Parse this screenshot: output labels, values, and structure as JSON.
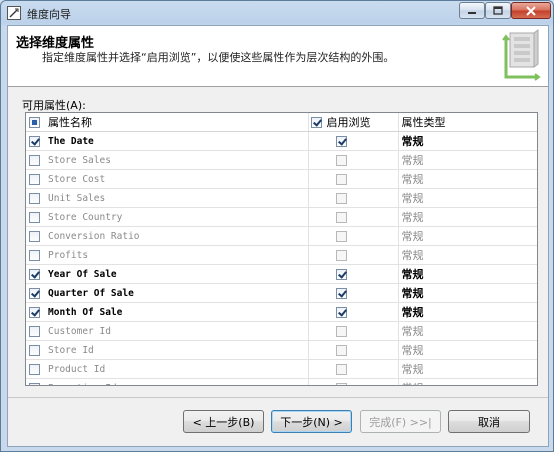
{
  "window": {
    "title": "维度向导"
  },
  "header": {
    "title": "选择维度属性",
    "subtitle": "指定维度属性并选择“启用浏览”，以便使这些属性作为层次结构的外围。"
  },
  "list": {
    "label": "可用属性(A):",
    "columns": {
      "name": "属性名称",
      "browse": "启用浏览",
      "type": "属性类型"
    },
    "header_name_checkbox": "partial",
    "header_browse_checkbox": "checked",
    "rows": [
      {
        "name": "The Date",
        "selected": true,
        "browse": true,
        "type": "常规"
      },
      {
        "name": "Store Sales",
        "selected": false,
        "browse": false,
        "type": "常规"
      },
      {
        "name": "Store Cost",
        "selected": false,
        "browse": false,
        "type": "常规"
      },
      {
        "name": "Unit Sales",
        "selected": false,
        "browse": false,
        "type": "常规"
      },
      {
        "name": "Store Country",
        "selected": false,
        "browse": false,
        "type": "常规"
      },
      {
        "name": "Conversion Ratio",
        "selected": false,
        "browse": false,
        "type": "常规"
      },
      {
        "name": "Profits",
        "selected": false,
        "browse": false,
        "type": "常规"
      },
      {
        "name": "Year Of Sale",
        "selected": true,
        "browse": true,
        "type": "常规"
      },
      {
        "name": "Quarter Of Sale",
        "selected": true,
        "browse": true,
        "type": "常规"
      },
      {
        "name": "Month Of Sale",
        "selected": true,
        "browse": true,
        "type": "常规"
      },
      {
        "name": "Customer Id",
        "selected": false,
        "browse": false,
        "type": "常规"
      },
      {
        "name": "Store Id",
        "selected": false,
        "browse": false,
        "type": "常规"
      },
      {
        "name": "Product Id",
        "selected": false,
        "browse": false,
        "type": "常规"
      },
      {
        "name": "Promotion Id",
        "selected": false,
        "browse": false,
        "type": "常规"
      }
    ]
  },
  "buttons": {
    "back": "< 上一步(B)",
    "next": "下一步(N) >",
    "finish": "完成(F) >>|",
    "cancel": "取消"
  },
  "colors": {
    "accent": "#3c7fb1",
    "disabled_text": "#8a8a8a",
    "close": "#c2402a"
  }
}
